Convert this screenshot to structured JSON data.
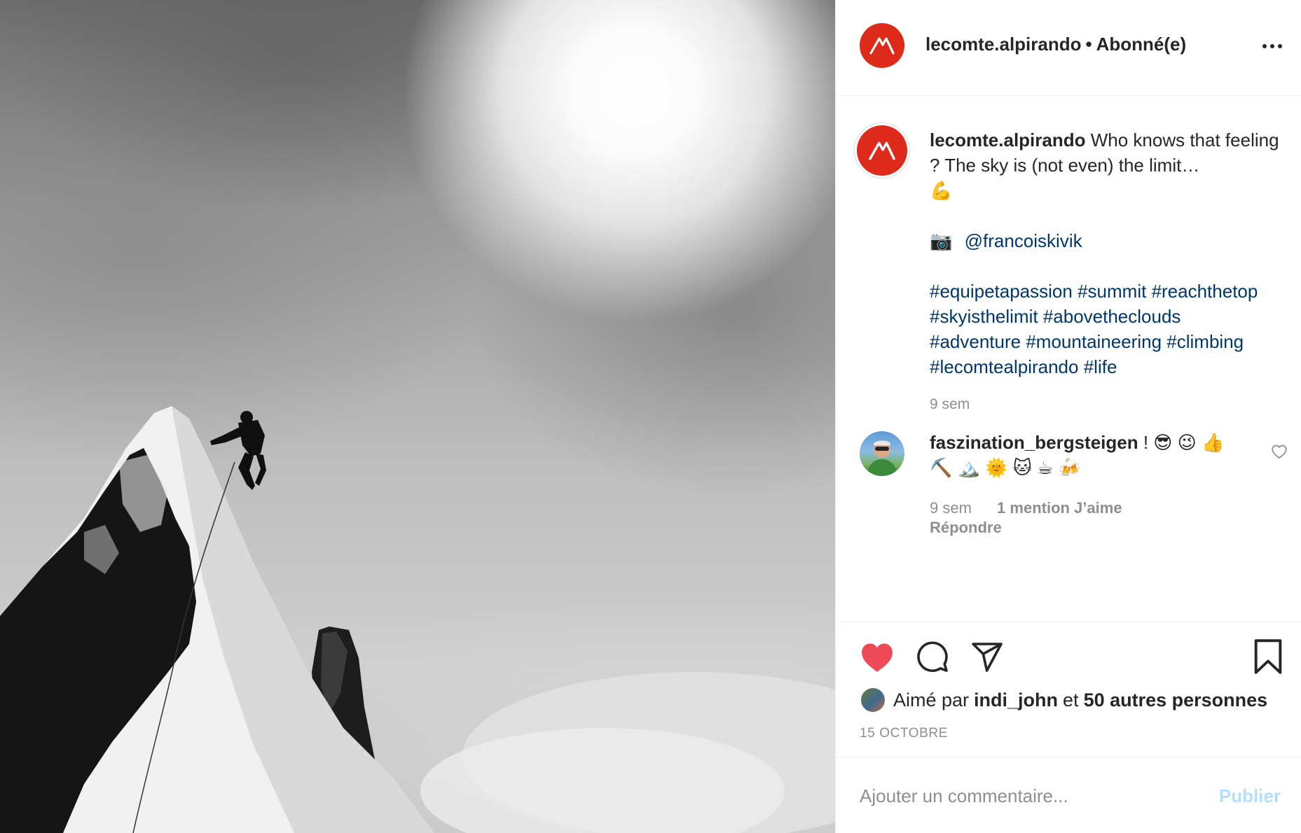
{
  "header": {
    "username": "lecomte.alpirando",
    "separator": "•",
    "follow_status": "Abonné(e)"
  },
  "caption": {
    "username": "lecomte.alpirando",
    "text": "Who knows that feeling ? The sky is (not even) the limit…",
    "emoji_1": "💪",
    "camera_emoji": "📷",
    "mention": "@francoiskivik",
    "hashtags": [
      "#equipetapassion",
      "#summit",
      "#reachthetop",
      "#skyisthelimit",
      "#abovetheclouds",
      "#adventure",
      "#mountaineering",
      "#climbing",
      "#lecomtealpirando",
      "#life"
    ],
    "time": "9 sem"
  },
  "comment": {
    "username": "faszination_bergsteigen",
    "text_line1": "! 😎 😉 👍",
    "text_line2": "⛏️ 🏔️ 🌞 🐱 ☕ 🍻",
    "time": "9 sem",
    "likes": "1 mention J’aime",
    "reply": "Répondre"
  },
  "likes": {
    "prefix": "Aimé par",
    "user": "indi_john",
    "connector": "et",
    "others": "50 autres personnes"
  },
  "date": "15 OCTOBRE",
  "add_comment": {
    "placeholder": "Ajouter un commentaire...",
    "publish": "Publier"
  },
  "colors": {
    "brand_red": "#dd2a1b",
    "like_red": "#ed4956",
    "link_blue": "#00376b",
    "publish_disabled": "#b2dffc"
  },
  "icons": [
    "more-options-icon",
    "heart-icon",
    "comment-icon",
    "share-icon",
    "bookmark-icon",
    "comment-heart-icon"
  ]
}
